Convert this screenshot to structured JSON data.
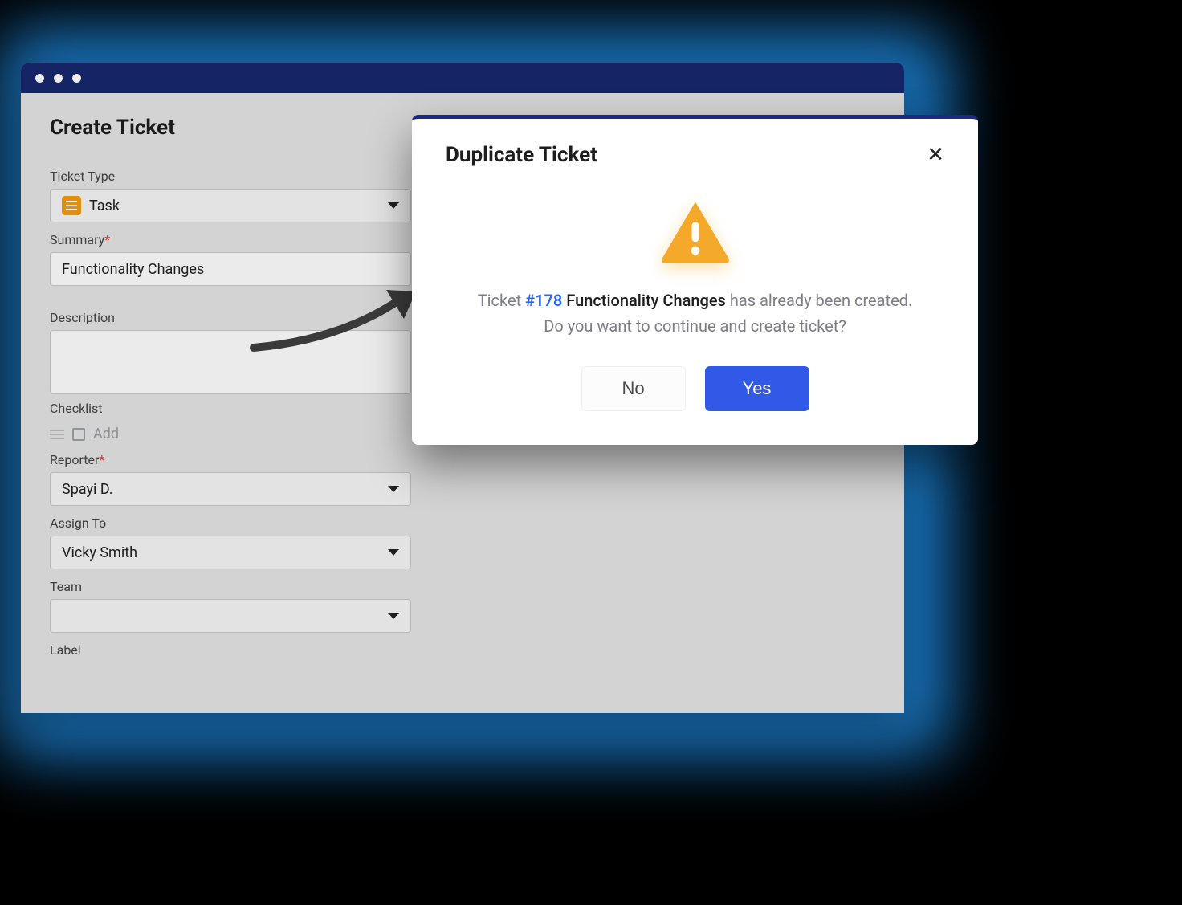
{
  "page": {
    "title": "Create Ticket"
  },
  "fields": {
    "ticket_type": {
      "label": "Ticket Type",
      "value": "Task"
    },
    "summary": {
      "label": "Summary",
      "value": "Functionality Changes",
      "required": true
    },
    "description": {
      "label": "Description",
      "value": ""
    },
    "checklist": {
      "label": "Checklist",
      "add_label": "Add"
    },
    "reporter": {
      "label": "Reporter",
      "value": "Spayi D.",
      "required": true
    },
    "assign_to": {
      "label": "Assign To",
      "value": "Vicky Smith"
    },
    "team": {
      "label": "Team",
      "value": ""
    },
    "label_field": {
      "label": "Label",
      "value": ""
    }
  },
  "modal": {
    "title": "Duplicate Ticket",
    "prefix": "Ticket ",
    "ticket_ref": "#178",
    "ticket_name": "Functionality Changes",
    "suffix": " has already been created.",
    "line2": "Do you want to continue and create ticket?",
    "no_label": "No",
    "yes_label": "Yes"
  }
}
